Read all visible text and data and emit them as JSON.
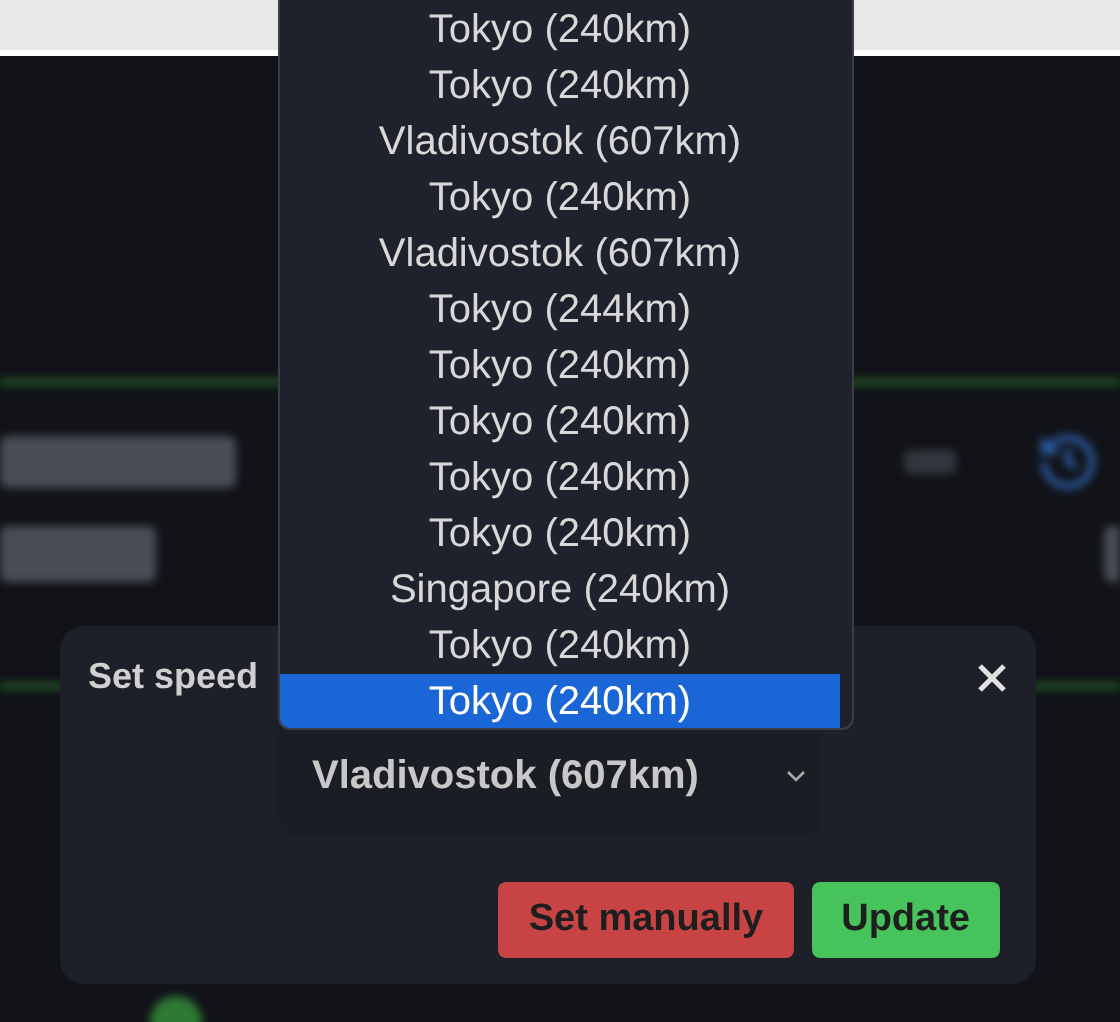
{
  "dialog": {
    "title": "Set speed",
    "select_value": "Vladivostok (607km)",
    "buttons": [
      {
        "label": "Set manually",
        "kind": "danger"
      },
      {
        "label": "Update",
        "kind": "primary"
      }
    ]
  },
  "dropdown": {
    "options": [
      {
        "label": "Tokyo (240km)",
        "selected": false
      },
      {
        "label": "Tokyo (240km)",
        "selected": false
      },
      {
        "label": "Vladivostok (607km)",
        "selected": false
      },
      {
        "label": "Tokyo (240km)",
        "selected": false
      },
      {
        "label": "Vladivostok (607km)",
        "selected": false
      },
      {
        "label": "Tokyo (244km)",
        "selected": false
      },
      {
        "label": "Tokyo (240km)",
        "selected": false
      },
      {
        "label": "Tokyo (240km)",
        "selected": false
      },
      {
        "label": "Tokyo (240km)",
        "selected": false
      },
      {
        "label": "Tokyo (240km)",
        "selected": false
      },
      {
        "label": "Singapore (240km)",
        "selected": false
      },
      {
        "label": "Tokyo (240km)",
        "selected": false
      },
      {
        "label": "Tokyo (240km)",
        "selected": true
      }
    ]
  }
}
